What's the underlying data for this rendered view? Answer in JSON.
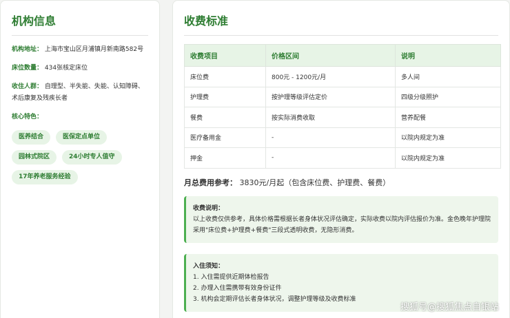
{
  "left": {
    "title": "机构信息",
    "address_label": "机构地址：",
    "address": "上海市宝山区月浦镇月新南路582号",
    "beds_label": "床位数量：",
    "beds": "434张核定床位",
    "residents_label": "收住人群：",
    "residents": "自理型、半失能、失能、认知障碍、术后康复及残疾长者",
    "features_label": "核心特色：",
    "tags": [
      "医养结合",
      "医保定点单位",
      "园林式院区",
      "24小时专人值守",
      "17年养老服务经验"
    ]
  },
  "right": {
    "title": "收费标准",
    "columns": [
      "收费项目",
      "价格区间",
      "说明"
    ],
    "rows": [
      [
        "床位费",
        "800元 - 1200元/月",
        "多人间"
      ],
      [
        "护理费",
        "按护理等级评估定价",
        "四级分级照护"
      ],
      [
        "餐费",
        "按实际消费收取",
        "营养配餐"
      ],
      [
        "医疗备用金",
        "-",
        "以院内规定为准"
      ],
      [
        "押金",
        "-",
        "以院内规定为准"
      ]
    ],
    "total_label": "月总费用参考：",
    "total_value": "3830元/月起（包含床位费、护理费、餐费）",
    "fee_note_title": "收费说明：",
    "fee_note_body": "以上收费仅供参考，具体价格需根据长者身体状况评估确定，实际收费以院内评估报价为准。金色晚年护理院采用\"床位费+护理费+餐费\"三段式透明收费，无隐形消费。",
    "admission_title": "入住须知：",
    "admission_items": [
      "1. 入住需提供近期体检报告",
      "2. 办理入住需携带有效身份证件",
      "3. 机构会定期评估长者身体状况，调整护理等级及收费标准"
    ]
  },
  "watermark": "搜狐号@搜狐焦点自银站"
}
